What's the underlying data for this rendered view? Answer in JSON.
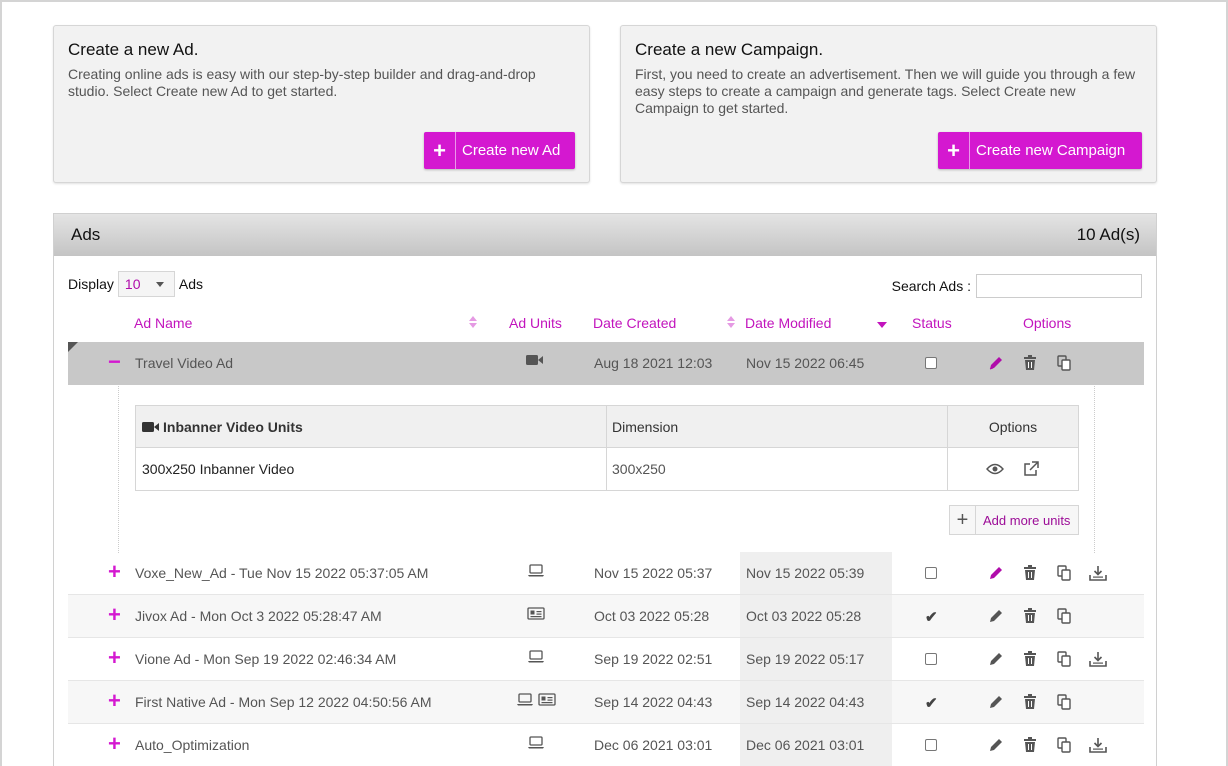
{
  "create_ad": {
    "title": "Create a new Ad.",
    "description": "Creating online ads is easy with our step-by-step builder and drag-and-drop studio. Select Create new Ad to get started.",
    "button_icon": "+",
    "button_label": "Create new Ad"
  },
  "create_campaign": {
    "title": "Create a new Campaign.",
    "description": "First, you need to create an advertisement. Then we will guide you through a few easy steps to create a campaign and generate tags. Select Create new Campaign to get started.",
    "button_icon": "+",
    "button_label": "Create new Campaign"
  },
  "ads_panel": {
    "title": "Ads",
    "count": "10 Ad(s)",
    "display_label": "Display",
    "display_value": "10",
    "display_suffix": "Ads",
    "search_label": "Search Ads :",
    "search_value": "",
    "columns": {
      "name": "Ad Name",
      "units": "Ad Units",
      "created": "Date Created",
      "modified": "Date Modified",
      "status": "Status",
      "options": "Options"
    }
  },
  "selected_row": {
    "expander": "−",
    "name": "Travel Video Ad",
    "unit_icons": [
      "video-icon"
    ],
    "created": "Aug 18 2021 12:03",
    "modified": "Nov 15 2022 06:45",
    "status": "unchecked"
  },
  "unit_table": {
    "header_unit": "Inbanner Video Units",
    "header_dimension": "Dimension",
    "header_options": "Options",
    "rows": [
      {
        "unit": "300x250 Inbanner Video",
        "dimension": "300x250"
      }
    ],
    "add_more_icon": "+",
    "add_more_label": "Add more units"
  },
  "rows": [
    {
      "expander": "+",
      "name": "Voxe_New_Ad - Tue Nov 15 2022 05:37:05 AM",
      "unit_icons": [
        "laptop-icon"
      ],
      "created": "Nov 15 2022 05:37",
      "modified": "Nov 15 2022 05:39",
      "status": "unchecked",
      "has_download": true,
      "edit_highlight": true
    },
    {
      "expander": "+",
      "name": "Jivox Ad - Mon Oct 3 2022 05:28:47 AM",
      "unit_icons": [
        "native-card-icon"
      ],
      "created": "Oct 03 2022 05:28",
      "modified": "Oct 03 2022 05:28",
      "status": "checked",
      "has_download": false,
      "edit_highlight": false
    },
    {
      "expander": "+",
      "name": "Vione Ad - Mon Sep 19 2022 02:46:34 AM",
      "unit_icons": [
        "laptop-icon"
      ],
      "created": "Sep 19 2022 02:51",
      "modified": "Sep 19 2022 05:17",
      "status": "unchecked",
      "has_download": true,
      "edit_highlight": false
    },
    {
      "expander": "+",
      "name": "First Native Ad - Mon Sep 12 2022 04:50:56 AM",
      "unit_icons": [
        "laptop-icon",
        "native-card-icon"
      ],
      "created": "Sep 14 2022 04:43",
      "modified": "Sep 14 2022 04:43",
      "status": "checked",
      "has_download": false,
      "edit_highlight": false
    },
    {
      "expander": "+",
      "name": "Auto_Optimization",
      "unit_icons": [
        "laptop-icon"
      ],
      "created": "Dec 06 2021 03:01",
      "modified": "Dec 06 2021 03:01",
      "status": "unchecked",
      "has_download": true,
      "edit_highlight": false
    }
  ],
  "colors": {
    "accent": "#d418d0",
    "header_text": "#c214bd",
    "panel_header": "#c8c8c8",
    "selected_row": "#c8c8c8"
  }
}
